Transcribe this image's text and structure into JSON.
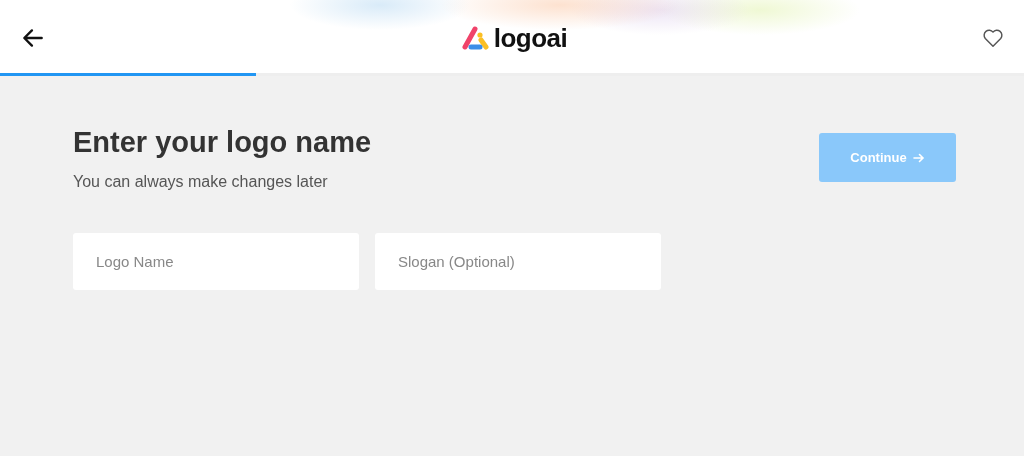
{
  "header": {
    "logo_text": "logoai",
    "progress": {
      "level": 0.25
    }
  },
  "heading": "Enter your logo name",
  "subheading": "You can always make changes later",
  "continue_button": {
    "label": "Continue",
    "disabled": true
  },
  "fields": [
    {
      "placeholder": "Logo Name"
    },
    {
      "placeholder": "Slogan (Optional)"
    }
  ]
}
